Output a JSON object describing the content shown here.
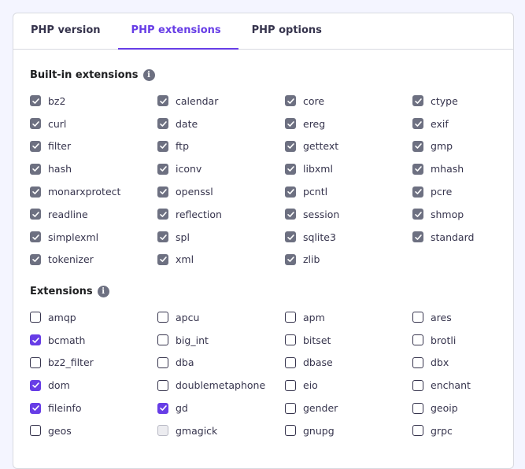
{
  "tabs": [
    {
      "label": "PHP version",
      "active": false
    },
    {
      "label": "PHP extensions",
      "active": true
    },
    {
      "label": "PHP options",
      "active": false
    }
  ],
  "builtin": {
    "title": "Built-in extensions",
    "items": [
      "bz2",
      "calendar",
      "core",
      "ctype",
      "curl",
      "date",
      "ereg",
      "exif",
      "filter",
      "ftp",
      "gettext",
      "gmp",
      "hash",
      "iconv",
      "libxml",
      "mhash",
      "monarxprotect",
      "openssl",
      "pcntl",
      "pcre",
      "readline",
      "reflection",
      "session",
      "shmop",
      "simplexml",
      "spl",
      "sqlite3",
      "standard",
      "tokenizer",
      "xml",
      "zlib"
    ]
  },
  "extensions": {
    "title": "Extensions",
    "items": [
      {
        "label": "amqp",
        "state": "unchecked"
      },
      {
        "label": "apcu",
        "state": "unchecked"
      },
      {
        "label": "apm",
        "state": "unchecked"
      },
      {
        "label": "ares",
        "state": "unchecked"
      },
      {
        "label": "bcmath",
        "state": "checked"
      },
      {
        "label": "big_int",
        "state": "unchecked"
      },
      {
        "label": "bitset",
        "state": "unchecked"
      },
      {
        "label": "brotli",
        "state": "unchecked"
      },
      {
        "label": "bz2_filter",
        "state": "unchecked"
      },
      {
        "label": "dba",
        "state": "unchecked"
      },
      {
        "label": "dbase",
        "state": "unchecked"
      },
      {
        "label": "dbx",
        "state": "unchecked"
      },
      {
        "label": "dom",
        "state": "checked"
      },
      {
        "label": "doublemetaphone",
        "state": "unchecked"
      },
      {
        "label": "eio",
        "state": "unchecked"
      },
      {
        "label": "enchant",
        "state": "unchecked"
      },
      {
        "label": "fileinfo",
        "state": "checked"
      },
      {
        "label": "gd",
        "state": "checked"
      },
      {
        "label": "gender",
        "state": "unchecked"
      },
      {
        "label": "geoip",
        "state": "unchecked"
      },
      {
        "label": "geos",
        "state": "unchecked"
      },
      {
        "label": "gmagick",
        "state": "disabled"
      },
      {
        "label": "gnupg",
        "state": "unchecked"
      },
      {
        "label": "grpc",
        "state": "unchecked"
      }
    ]
  },
  "colors": {
    "accent": "#673de6",
    "builtin_checkbox": "#6d7081",
    "text": "#36344d"
  },
  "icons": {
    "info": "info-icon",
    "check": "check-icon"
  }
}
